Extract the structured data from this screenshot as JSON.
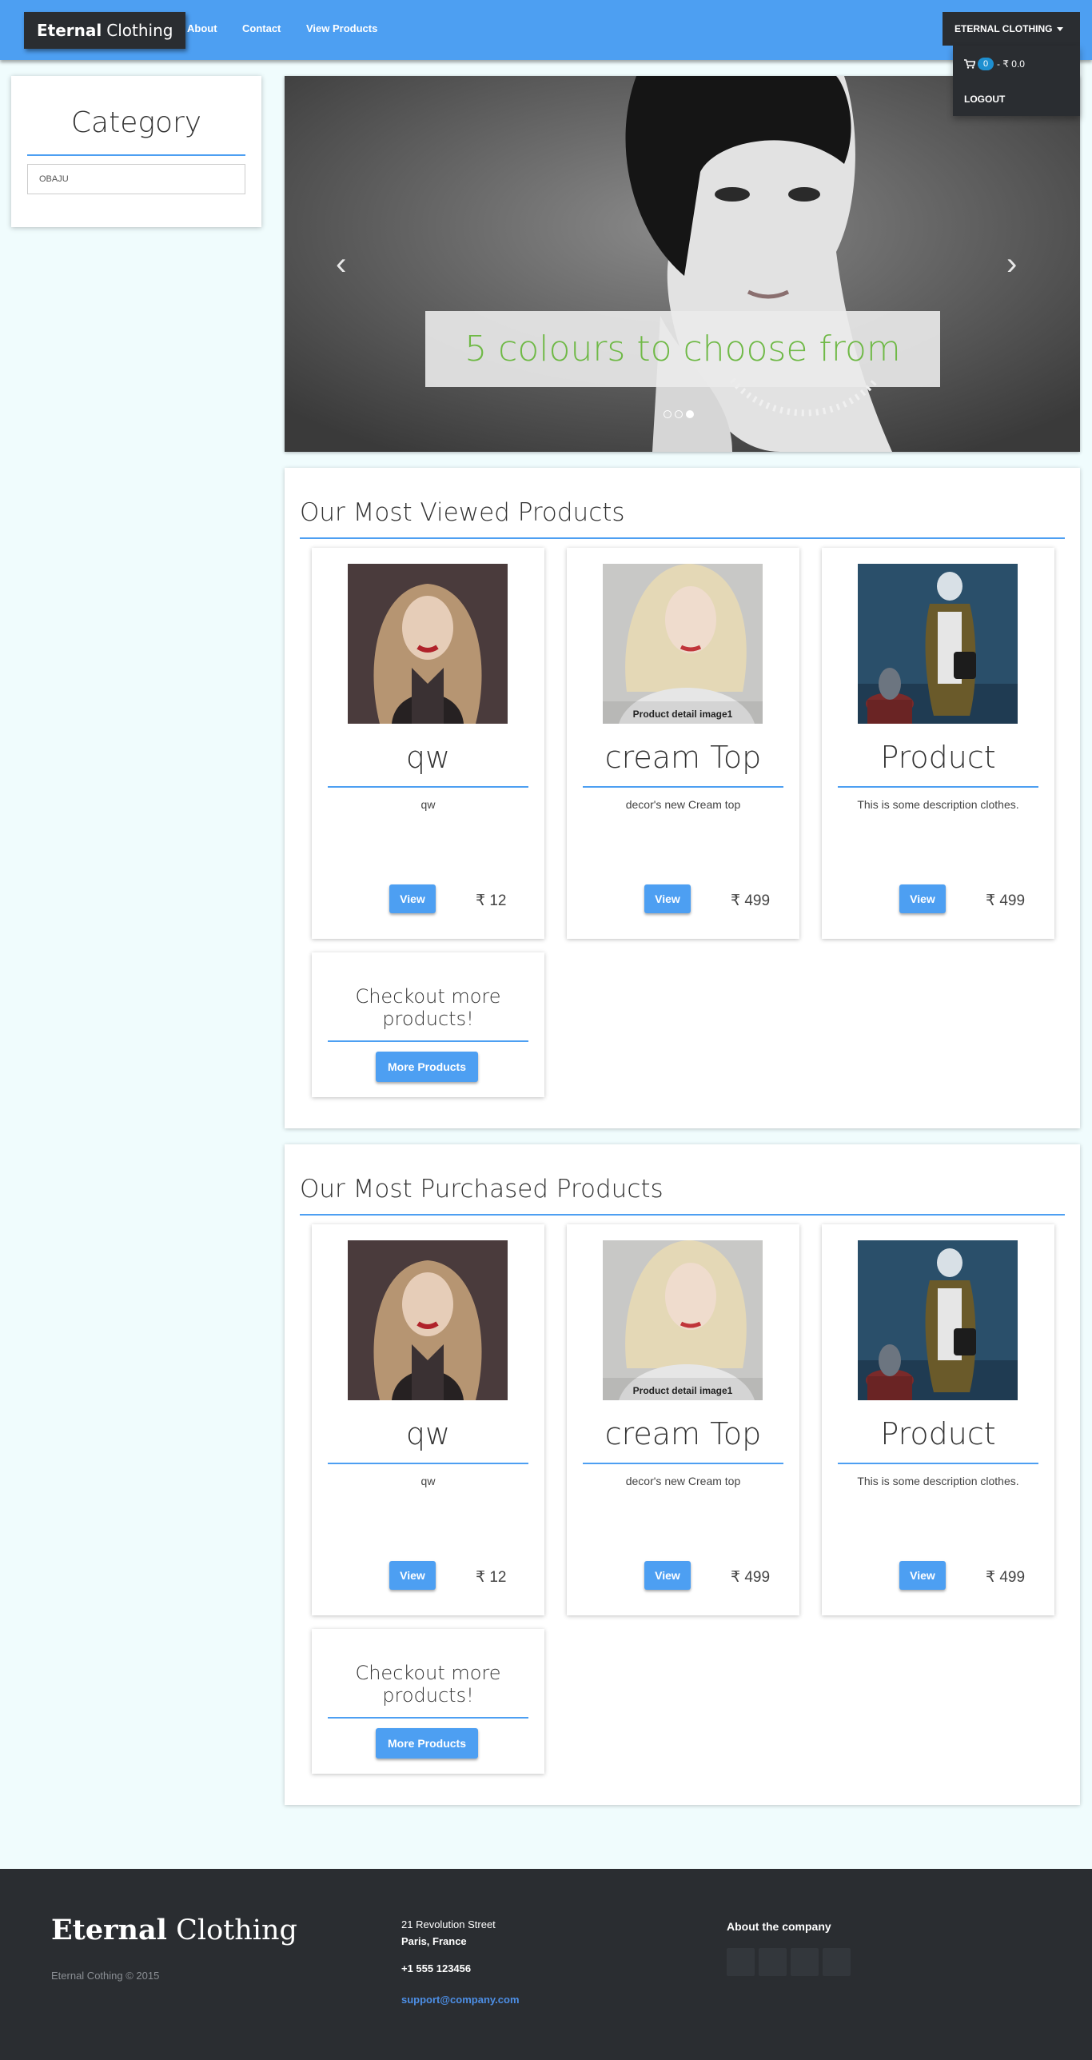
{
  "navbar": {
    "brand_bold": "Eternal",
    "brand_thin": "Clothing",
    "links": [
      "About",
      "Contact",
      "View Products"
    ],
    "user_menu": "ETERNAL CLOTHING",
    "cart_count": "0",
    "cart_total": "- ₹ 0.0",
    "logout": "LOGOUT"
  },
  "sidebar": {
    "title": "Category",
    "items": [
      "OBAJU"
    ]
  },
  "carousel": {
    "caption": "5 colours to choose from",
    "slide_count": 3,
    "active_slide": 3
  },
  "most_viewed": {
    "title": "Our Most Viewed Products",
    "products": [
      {
        "name": "qw",
        "description": "qw",
        "view": "View",
        "price": "₹ 12"
      },
      {
        "name": "cream Top",
        "description": "decor's new Cream top",
        "view": "View",
        "price": "₹ 499",
        "image_caption": "Product detail image1"
      },
      {
        "name": "Product",
        "description": "This is some description clothes.",
        "view": "View",
        "price": "₹ 499"
      }
    ],
    "more_title": "Checkout more products!",
    "more_button": "More Products"
  },
  "most_purchased": {
    "title": "Our Most Purchased Products",
    "products": [
      {
        "name": "qw",
        "description": "qw",
        "view": "View",
        "price": "₹ 12"
      },
      {
        "name": "cream Top",
        "description": "decor's new Cream top",
        "view": "View",
        "price": "₹ 499",
        "image_caption": "Product detail image1"
      },
      {
        "name": "Product",
        "description": "This is some description clothes.",
        "view": "View",
        "price": "₹ 499"
      }
    ],
    "more_title": "Checkout more products!",
    "more_button": "More Products"
  },
  "footer": {
    "logo_bold": "Eternal",
    "logo_thin": "Clothing",
    "copyright": "Eternal Cothing © 2015",
    "address_line1": "21 Revolution Street",
    "address_line2": "Paris, France",
    "phone": "+1 555 123456",
    "email": "support@company.com",
    "about_title": "About the company"
  },
  "colors": {
    "accent": "#4d9ff2",
    "dark": "#2a2d31",
    "page_bg": "#f0fcfd",
    "caption_green": "#6fb946"
  }
}
